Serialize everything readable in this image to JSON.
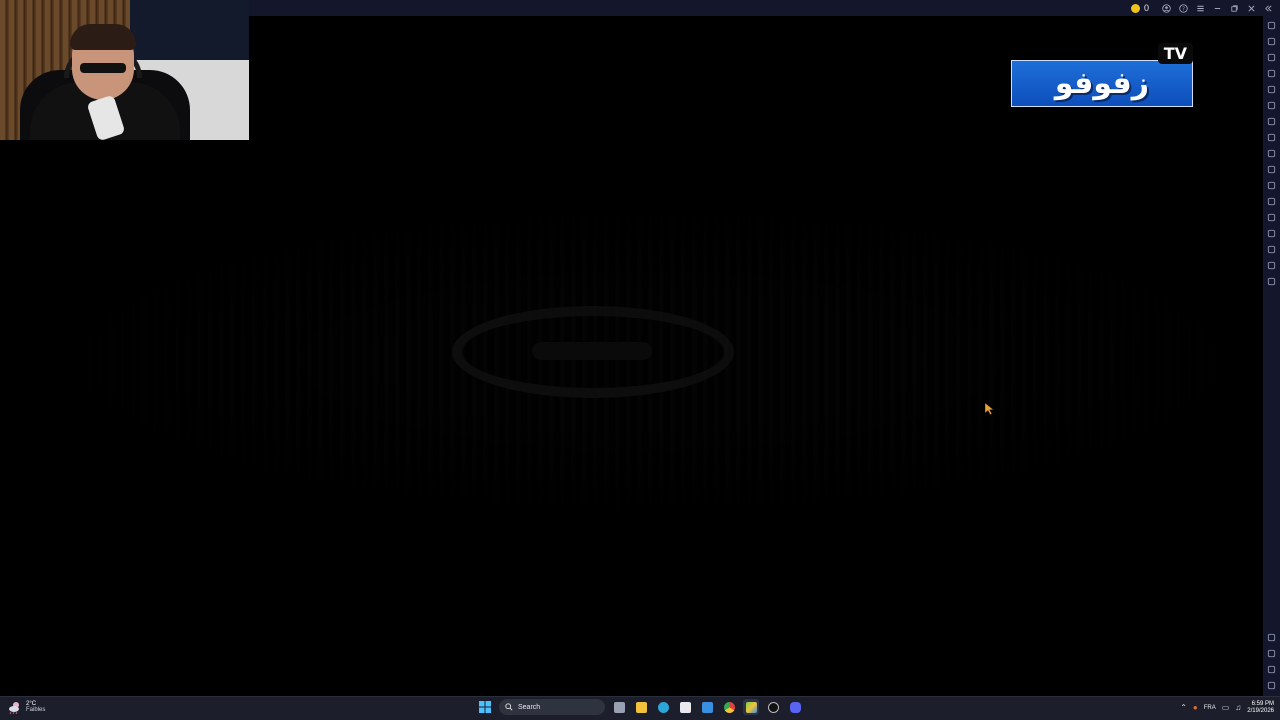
{
  "emulator": {
    "coin_count": "0",
    "titlebar_icons": [
      "account-icon",
      "help-icon",
      "menu-icon",
      "minimize-icon",
      "restore-icon",
      "close-icon",
      "collapse-icon"
    ],
    "side_toolbar": [
      "fullscreen-icon",
      "volume-icon",
      "play-store-icon",
      "install-apk-icon",
      "macro-icon",
      "rotate-icon",
      "gamepad-icon",
      "keyboard-icon",
      "screenshot-icon",
      "record-icon",
      "media-folder-icon",
      "shake-icon",
      "multi-instance-icon",
      "eco-mode-icon",
      "location-icon",
      "storage-icon",
      "sync-icon",
      "settings-icon",
      "back-icon",
      "home-icon",
      "recent-apps-icon"
    ]
  },
  "game": {
    "watermark_text": "زفوفو",
    "watermark_tv": "TV"
  },
  "taskbar": {
    "weather_temp": "2°C",
    "weather_desc": "Faibles",
    "search_placeholder": "Search",
    "apps": [
      "task-view-icon",
      "file-explorer-icon",
      "edge-icon",
      "store-icon",
      "mail-icon",
      "chrome-icon",
      "bluestacks-icon",
      "obs-icon",
      "discord-icon"
    ],
    "language": "FRA",
    "time": "6:59 PM",
    "date": "2/19/2026"
  },
  "colors": {
    "titlebar": "#14172c",
    "taskbar": "#1c1f2b",
    "watermark_blue": "#1f6fd8",
    "cursor": "#e8a13a"
  }
}
